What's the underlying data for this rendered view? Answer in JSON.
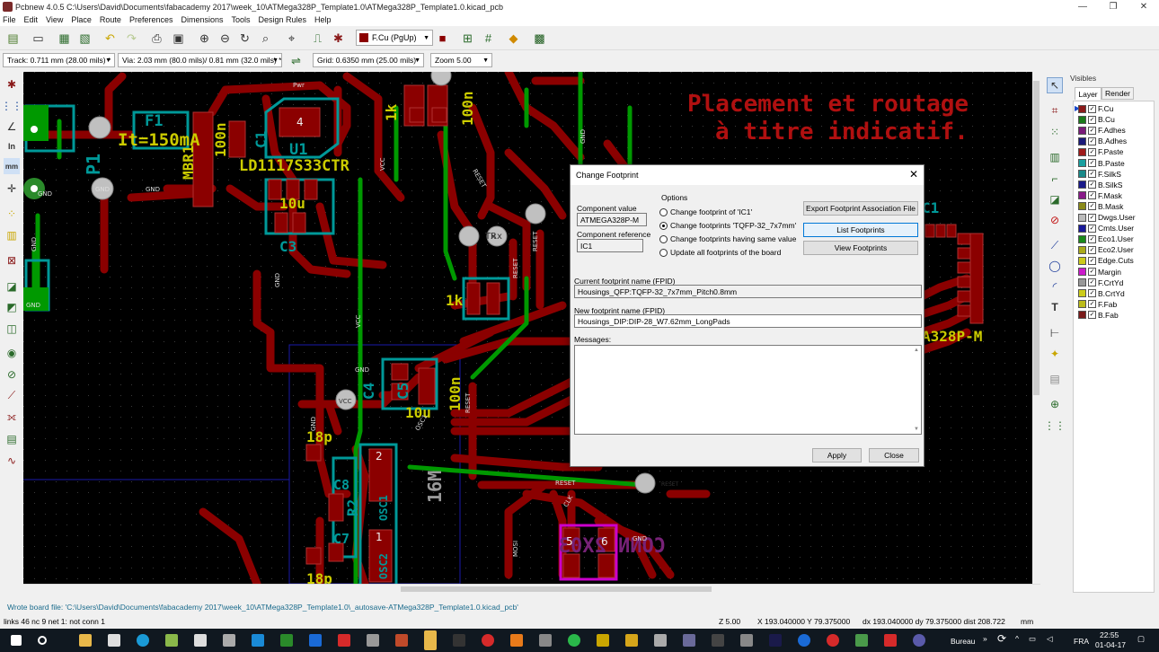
{
  "window": {
    "title": "Pcbnew 4.0.5 C:\\Users\\David\\Documents\\fabacademy 2017\\week_10\\ATMega328P_Template1.0\\ATMega328P_Template1.0.kicad_pcb",
    "minimize": "—",
    "maximize": "❐",
    "close": "✕"
  },
  "menu": [
    "File",
    "Edit",
    "View",
    "Place",
    "Route",
    "Preferences",
    "Dimensions",
    "Tools",
    "Design Rules",
    "Help"
  ],
  "toolbar": {
    "layer_select": "F.Cu (PgUp)",
    "track": "Track: 0.711 mm (28.00 mils) *",
    "via": "Via: 2.03 mm (80.0 mils)/ 0.81 mm (32.0 mils) *",
    "grid": "Grid: 0.6350 mm (25.00 mils)",
    "zoom": "Zoom 5.00"
  },
  "canvas_text": {
    "note_line1": "Placement et routage",
    "note_line2": "à titre indicatif.",
    "p1": "P1",
    "f1": "F1",
    "it": "It=150mA",
    "mbr": "MBR1",
    "u1": "U1",
    "ld": "LD1117S33CTR",
    "c1a": "C1",
    "r100n_top": "100n",
    "r1k_top": "1k",
    "r1k_mid": "1k",
    "c3": "C3",
    "ten_u": "10u",
    "c4": "C4",
    "c5": "C5",
    "c5_10u": "10u",
    "n100_mid": "100n",
    "p18a": "18p",
    "c8": "C8",
    "osc1": "OSC1",
    "m16": "16M",
    "r2": "R2",
    "c7": "C7",
    "osc2": "OSC2",
    "p18b": "18p",
    "conn": "CONN 2X03",
    "ic1": "C1",
    "atm": "A328P-M",
    "gnd1": "GND",
    "gnd2": "GND",
    "pwr": "Pwr",
    "vcc": "VCC",
    "reset": "RESET",
    "tx": "Tx",
    "rx": "Rx",
    "mosi": "MOSI",
    "clk": "CLK",
    "four": "4",
    "six": "6",
    "two": "2",
    "five": "5",
    "one": "1"
  },
  "layers_panel": {
    "header": "Visibles",
    "tab_layer": "Layer",
    "tab_render": "Render",
    "items": [
      {
        "name": "F.Cu",
        "color": "#8b1a1a"
      },
      {
        "name": "B.Cu",
        "color": "#1a7a1a"
      },
      {
        "name": "F.Adhes",
        "color": "#7a1a7a"
      },
      {
        "name": "B.Adhes",
        "color": "#1a1a7a"
      },
      {
        "name": "F.Paste",
        "color": "#a01a1a"
      },
      {
        "name": "B.Paste",
        "color": "#1aa0a0"
      },
      {
        "name": "F.SilkS",
        "color": "#1a8a8a"
      },
      {
        "name": "B.SilkS",
        "color": "#1a1a8a"
      },
      {
        "name": "F.Mask",
        "color": "#8a1a8a"
      },
      {
        "name": "B.Mask",
        "color": "#8a8a1a"
      },
      {
        "name": "Dwgs.User",
        "color": "#bbbbbb"
      },
      {
        "name": "Cmts.User",
        "color": "#1a1a9a"
      },
      {
        "name": "Eco1.User",
        "color": "#1a8a1a"
      },
      {
        "name": "Eco2.User",
        "color": "#aaaa1a"
      },
      {
        "name": "Edge.Cuts",
        "color": "#cccc1a"
      },
      {
        "name": "Margin",
        "color": "#cc1acc"
      },
      {
        "name": "F.CrtYd",
        "color": "#999999"
      },
      {
        "name": "B.CrtYd",
        "color": "#cccc1a"
      },
      {
        "name": "F.Fab",
        "color": "#bbbb1a"
      },
      {
        "name": "B.Fab",
        "color": "#7a1a1a"
      }
    ]
  },
  "dialog": {
    "title": "Change Footprint",
    "close": "✕",
    "component_value_label": "Component value",
    "component_value": "ATMEGA328P-M",
    "component_reference_label": "Component reference",
    "component_reference": "IC1",
    "options_label": "Options",
    "options": [
      "Change footprint of 'IC1'",
      "Change footprints 'TQFP-32_7x7mm'",
      "Change footprints having same value",
      "Update all footprints of the board"
    ],
    "selected_option": 1,
    "export_button": "Export Footprint Association File",
    "list_button": "List Footprints",
    "view_button": "View Footprints",
    "current_fpid_label": "Current footprint name (FPID)",
    "current_fpid": "Housings_QFP:TQFP-32_7x7mm_Pitch0.8mm",
    "new_fpid_label": "New footprint name (FPID)",
    "new_fpid": "Housings_DIP:DIP-28_W7.62mm_LongPads",
    "messages_label": "Messages:",
    "apply_button": "Apply",
    "close_button": "Close"
  },
  "message_line": "Wrote board file: 'C:\\Users\\David\\Documents\\fabacademy 2017\\week_10\\ATMega328P_Template1.0\\_autosave-ATMega328P_Template1.0.kicad_pcb'",
  "status": {
    "links": "links 46 nc 9  net 1: not conn 1",
    "zoom": "Z 5.00",
    "xy": "X 193.040000  Y 79.375000",
    "dxdy": "dx 193.040000  dy 79.375000  dist 208.722",
    "units": "mm"
  },
  "taskbar": {
    "bureau": "Bureau",
    "lang": "FRA",
    "time": "22:55",
    "date": "01-04-17"
  },
  "colors": {
    "fcu": "#8b0000",
    "bcu": "#009900",
    "silk": "#cccc00",
    "fsilk": "#009999",
    "pad": "#c0c0c0",
    "magenta": "#cc00cc",
    "blue": "#1a1aaa"
  }
}
